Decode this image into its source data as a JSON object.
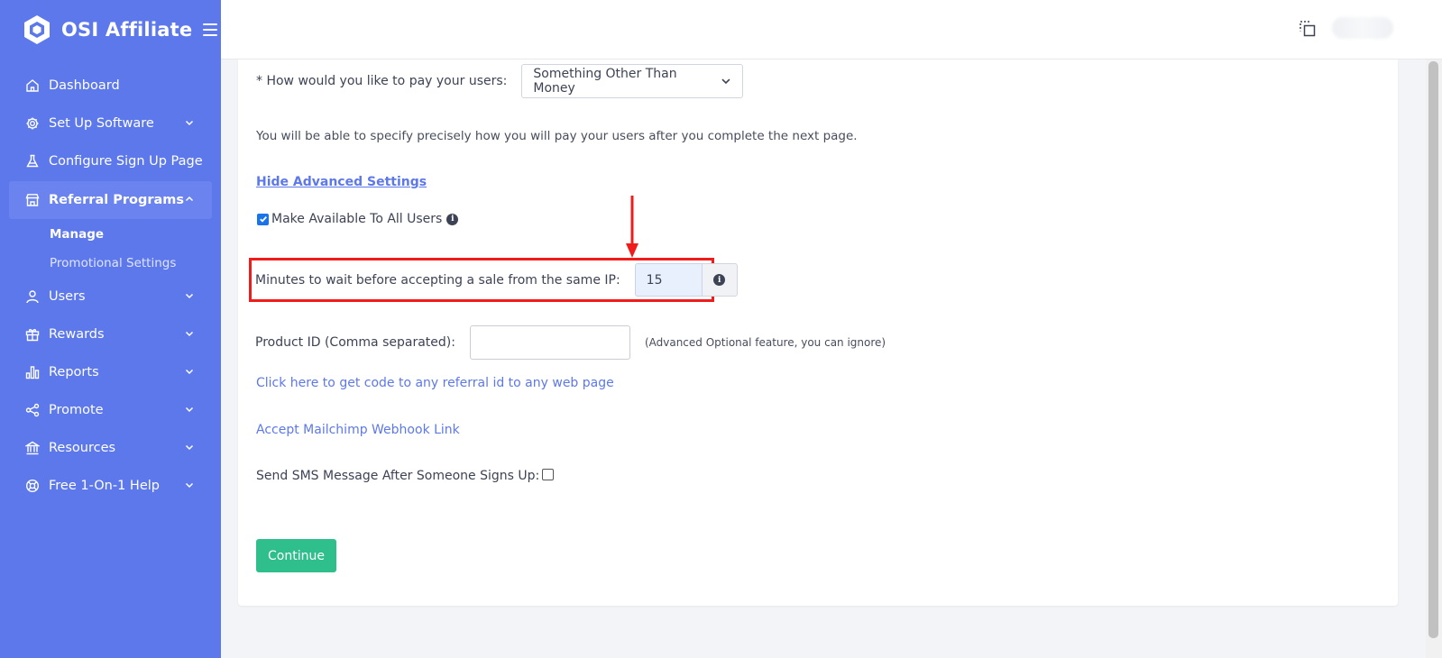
{
  "brand": {
    "name": "OSI Affiliate"
  },
  "sidebar": {
    "items": [
      {
        "label": "Dashboard",
        "icon": "home-icon"
      },
      {
        "label": "Set Up Software",
        "icon": "gear-icon"
      },
      {
        "label": "Configure Sign Up Page",
        "icon": "flask-icon"
      },
      {
        "label": "Referral Programs",
        "icon": "store-icon"
      },
      {
        "label": "Users",
        "icon": "user-icon"
      },
      {
        "label": "Rewards",
        "icon": "gift-icon"
      },
      {
        "label": "Reports",
        "icon": "bar-chart-icon"
      },
      {
        "label": "Promote",
        "icon": "share-icon"
      },
      {
        "label": "Resources",
        "icon": "bank-icon"
      },
      {
        "label": "Free 1-On-1 Help",
        "icon": "lifebuoy-icon"
      }
    ],
    "sub_items": [
      {
        "label": "Manage"
      },
      {
        "label": "Promotional Settings"
      }
    ]
  },
  "form": {
    "pay_label": "* How would you like to pay your users:",
    "pay_value": "Something Other Than Money",
    "pay_note": "You will be able to specify precisely how you will pay your users after you complete the next page.",
    "advanced_link": "Hide Advanced Settings",
    "available_label": "Make Available To All Users",
    "available_checked": true,
    "ip_label": "Minutes to wait before accepting a sale from the same IP:",
    "ip_value": "15",
    "product_label": "Product ID (Comma separated):",
    "product_value": "",
    "product_note": "(Advanced Optional feature, you can ignore)",
    "code_link": "Click here to get code to any referral id to any web page",
    "mailchimp_link": "Accept Mailchimp Webhook Link",
    "sms_label": "Send SMS Message After Someone Signs Up:",
    "sms_checked": false,
    "continue_label": "Continue"
  },
  "colors": {
    "sidebar": "#5d78eb",
    "accent": "#5d78eb",
    "continue": "#2fbf8c",
    "highlight": "#f01c1c"
  }
}
